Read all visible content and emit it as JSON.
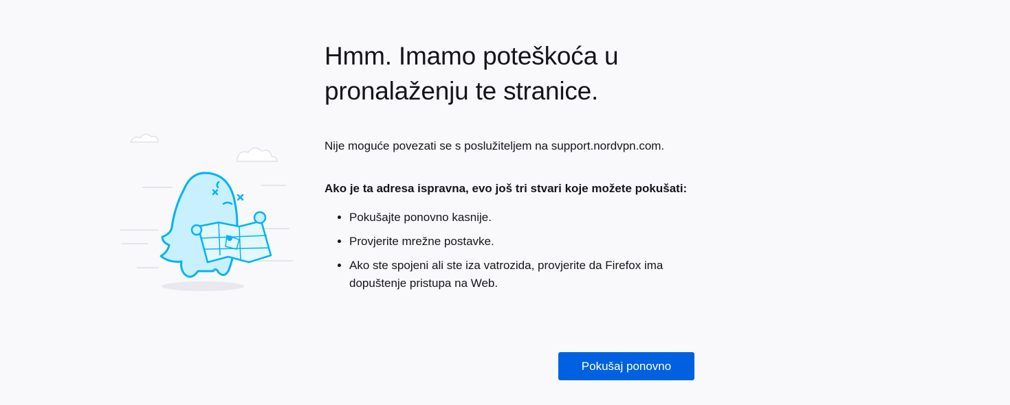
{
  "error_page": {
    "title": "Hmm. Imamo poteškoća u pronalaženju te stranice.",
    "description": "Nije moguće povezati se s poslužiteljem na support.nordvpn.com.",
    "suggestions_heading": "Ako je ta adresa ispravna, evo još tri stvari koje možete pokušati:",
    "suggestions": [
      "Pokušajte ponovno kasnije.",
      "Provjerite mrežne postavke.",
      "Ako ste spojeni ali ste iza vatrozida, provjerite da Firefox ima dopuštenje pristupa na Web."
    ],
    "retry_label": "Pokušaj ponovno",
    "illustration_icon": "lost-creature-with-map-illustration"
  },
  "colors": {
    "background": "#f9f9fb",
    "text": "#15141a",
    "button": "#0061e0",
    "illustration_stroke": "#00b3f4",
    "illustration_fill": "#c9f0ff"
  }
}
